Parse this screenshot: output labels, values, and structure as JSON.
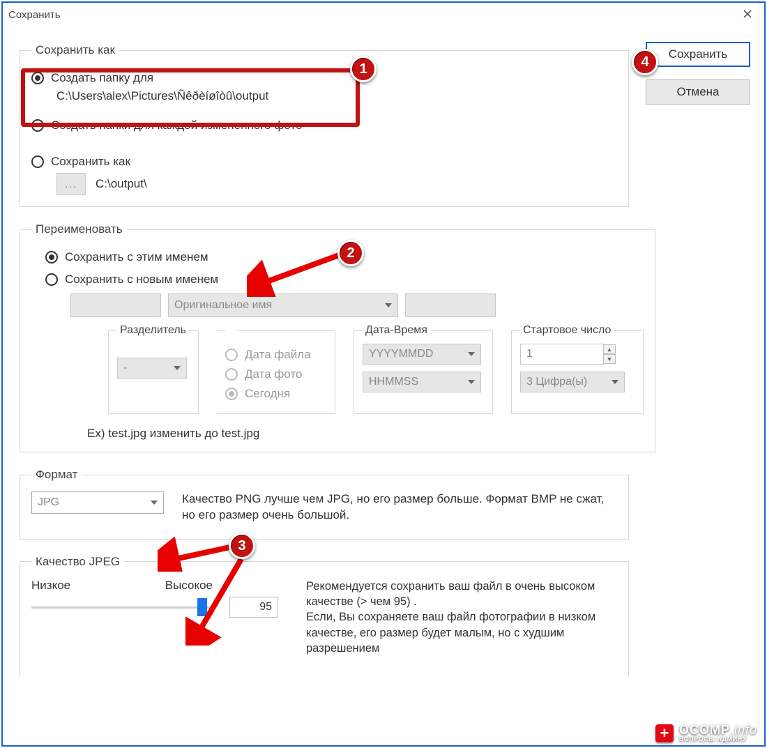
{
  "window": {
    "title": "Сохранить"
  },
  "buttons": {
    "save": "Сохранить",
    "cancel": "Отмена"
  },
  "saveAs": {
    "legend": "Сохранить как",
    "opt1": "Создать папку для",
    "opt1_path": "C:\\Users\\alex\\Pictures\\Ñêðèíøîòû\\output",
    "opt2": "Создать папки для каждой измененного фото",
    "opt3": "Сохранить как",
    "opt3_path": "C:\\output\\",
    "browse": "..."
  },
  "rename": {
    "legend": "Переименовать",
    "opt1": "Сохранить с этим именем",
    "opt2": "Сохранить с новым именем",
    "original": "Оригинальное имя",
    "sep": {
      "legend": "Разделитель",
      "value": "-"
    },
    "source": {
      "file": "Дата файла",
      "photo": "Дата фото",
      "today": "Сегодня"
    },
    "datetime": {
      "legend": "Дата-Время",
      "date": "YYYYMMDD",
      "time": "HHMMSS"
    },
    "startnum": {
      "legend": "Стартовое число",
      "value": "1",
      "digits": "3 Цифра(ы)"
    },
    "example": "Ex) test.jpg изменить до test.jpg"
  },
  "format": {
    "legend": "Формат",
    "value": "JPG",
    "note": "Качество PNG лучше чем JPG, но его размер  больше. Формат BMP не сжат, но его размер  очень большой."
  },
  "jpeg": {
    "legend": "Качество JPEG",
    "low": "Низкое",
    "high": "Высокое",
    "value": "95",
    "note": "Рекомендуется сохранить ваш файл в  очень высоком качестве (> чем 95) .\nЕсли, Вы сохраняете ваш файл фотографии в низком качестве, его размер будет малым, но с худшим  разрешением"
  },
  "markers": {
    "m1": "1",
    "m2": "2",
    "m3": "3",
    "m4": "4"
  },
  "watermark": {
    "brand": "OCOMP",
    "suffix": ".info",
    "tag": "ВОПРОСЫ АДМИНУ"
  }
}
